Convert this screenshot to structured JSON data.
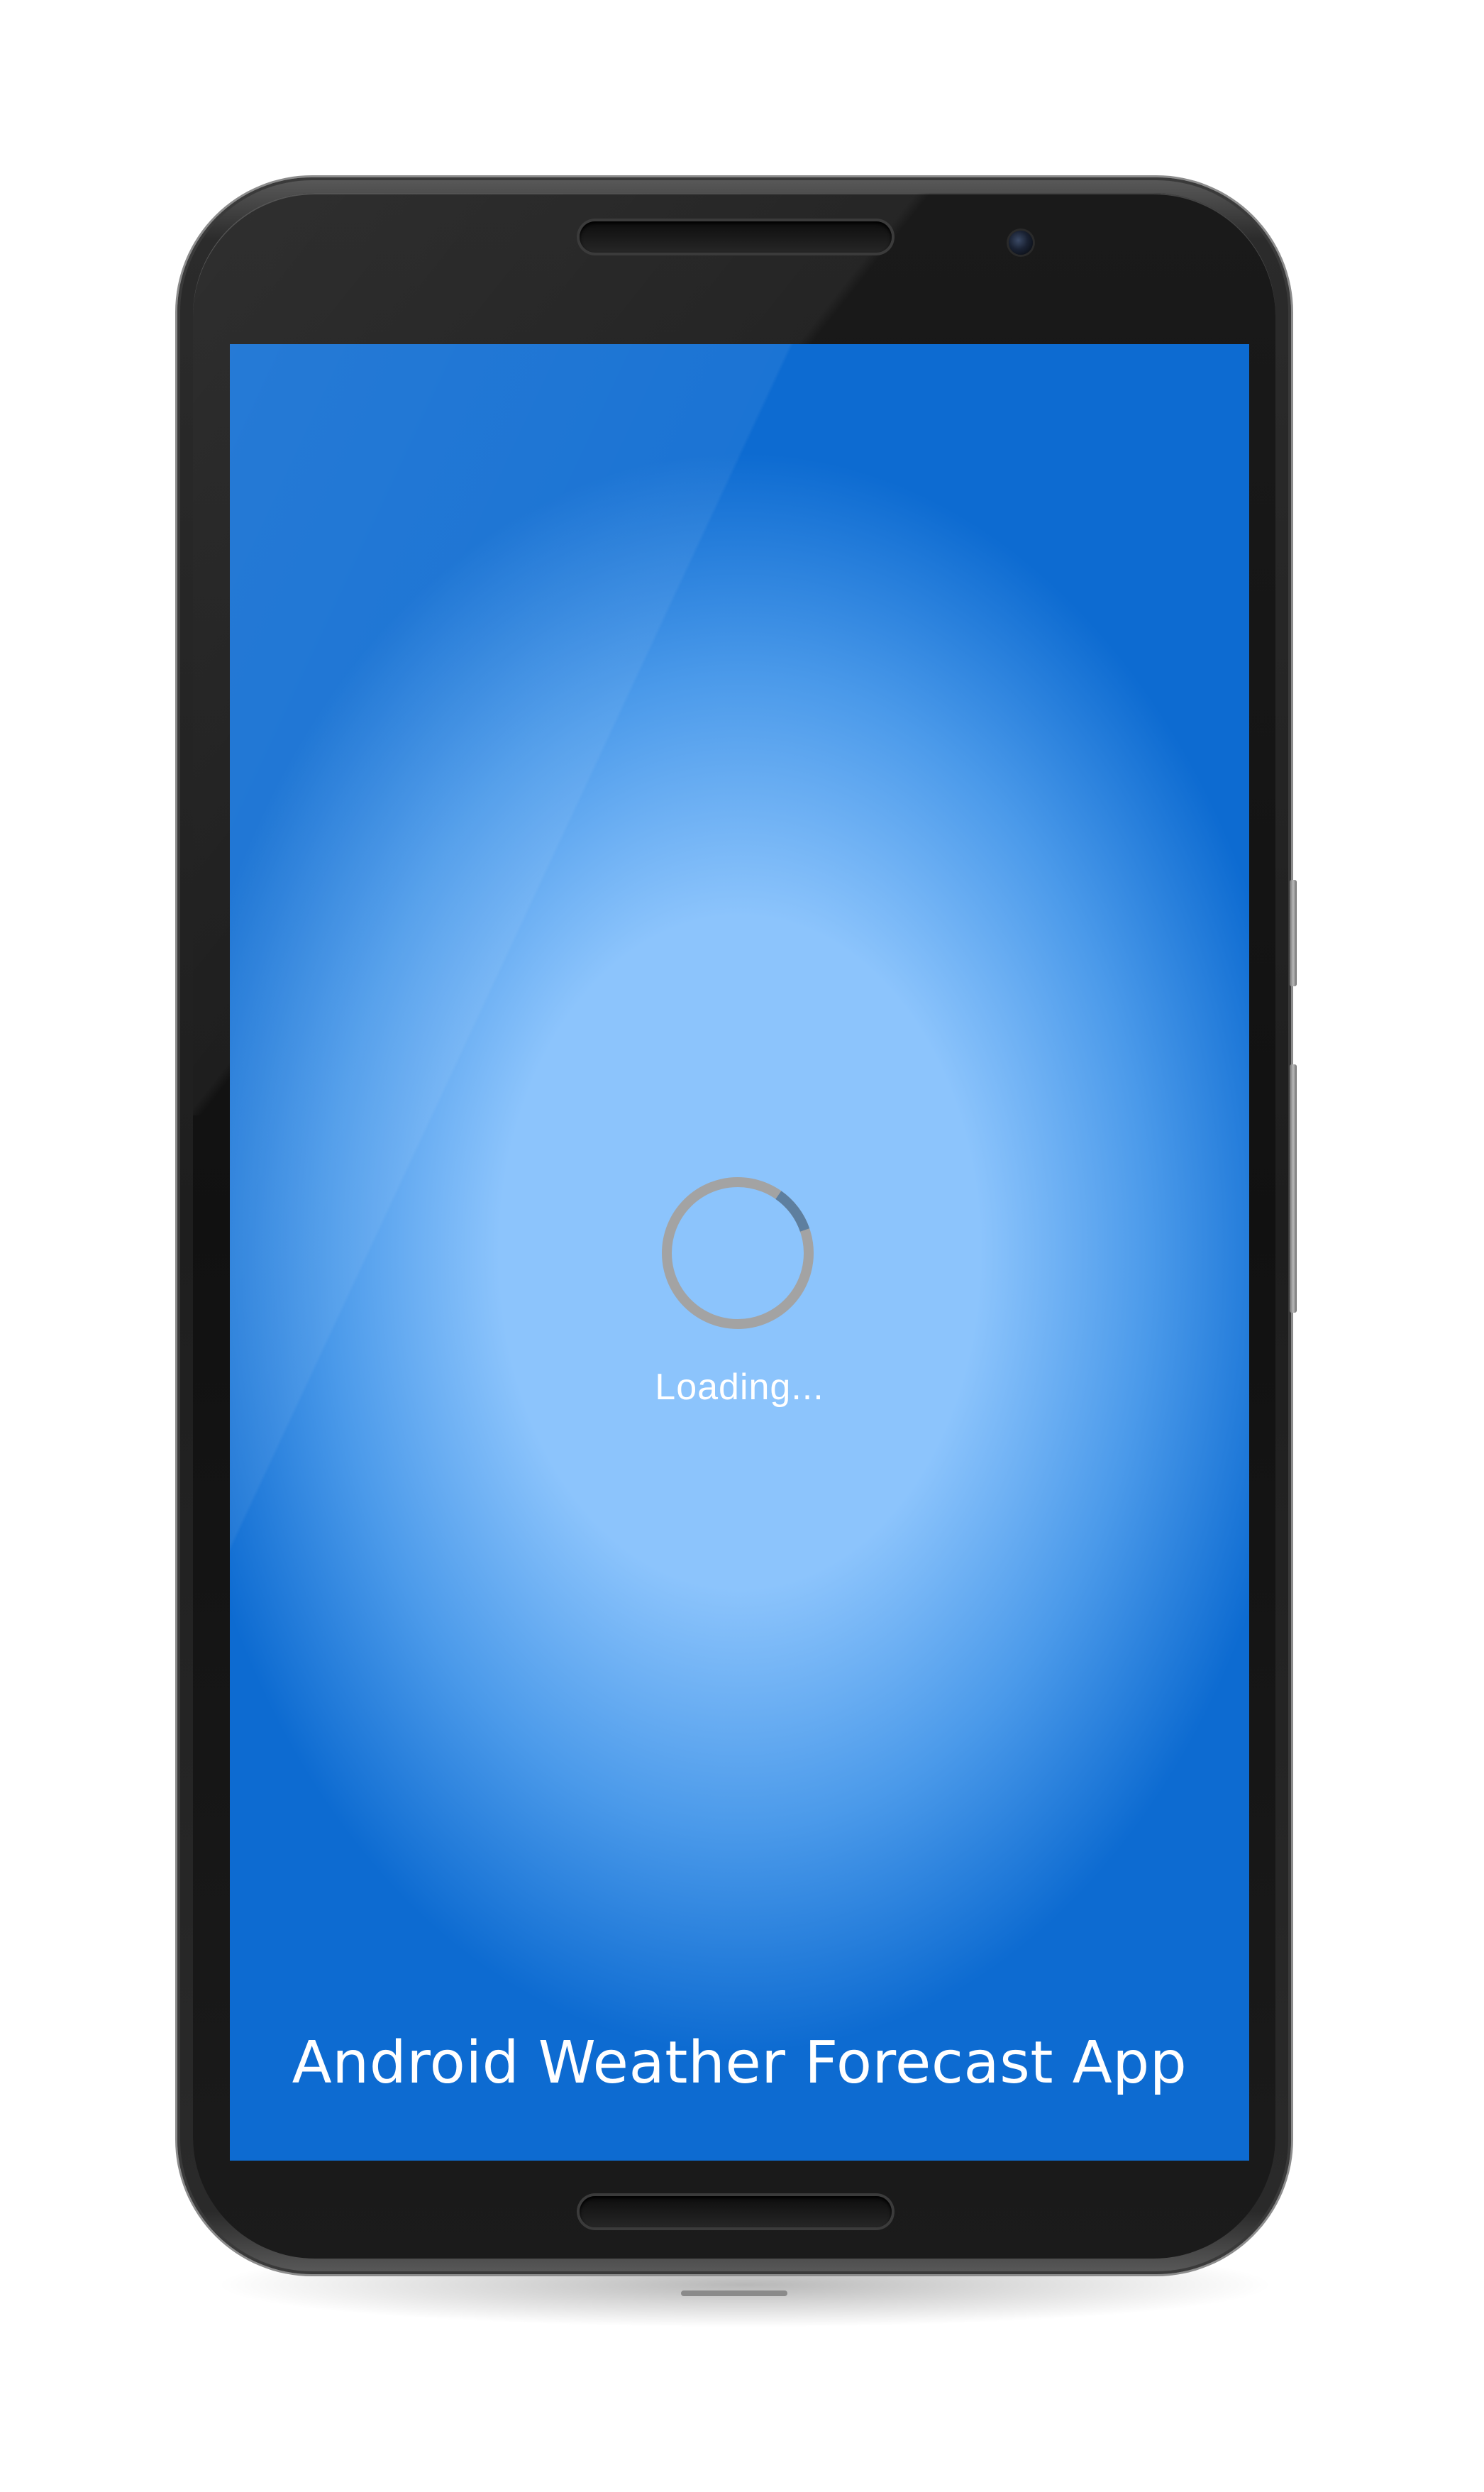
{
  "screen": {
    "loading_label": "Loading...",
    "footer_title": "Android Weather Forecast App",
    "progress_arc_fraction": 0.1
  },
  "colors": {
    "background_center": "#8cc4fc",
    "background_edge": "#0d6bd1",
    "spinner_track": "#a3a3a3",
    "spinner_arc": "#5e7f9f",
    "text": "#ffffff"
  },
  "icons": {
    "spinner": "progress-spinner-icon"
  }
}
